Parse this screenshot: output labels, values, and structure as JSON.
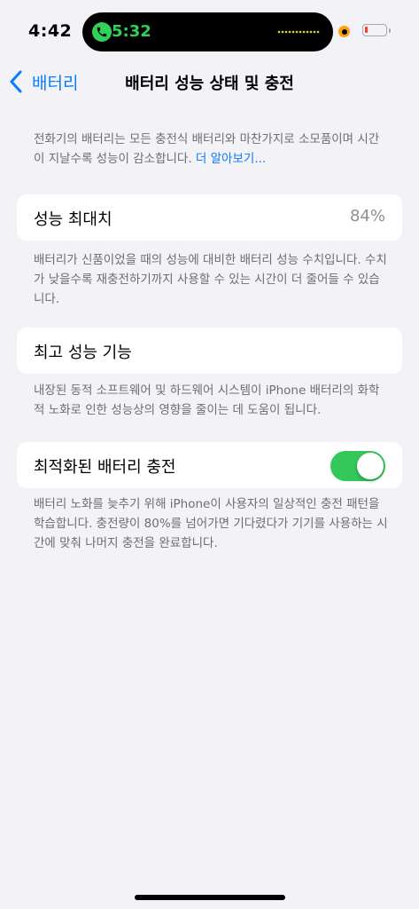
{
  "status_bar": {
    "time": "4:42",
    "island_call_time": "5:32",
    "call_color": "#30d158"
  },
  "nav": {
    "back_label": "배터리",
    "title": "배터리 성능 상태 및 충전",
    "accent": "#0a7aff"
  },
  "intro": {
    "text": "전화기의 배터리는 모든 충전식 배터리와 마찬가지로 소모품이며 시간이 지날수록 성능이 감소합니다.",
    "link": "더 알아보기..."
  },
  "max_capacity": {
    "label": "성능 최대치",
    "value": "84%",
    "footer": "배터리가 신품이었을 때의 성능에 대비한 배터리 성능 수치입니다. 수치가 낮을수록 재충전하기까지 사용할 수 있는 시간이 더 줄어들 수 있습니다."
  },
  "peak_performance": {
    "label": "최고 성능 기능",
    "footer": "내장된 동적 소프트웨어 및 하드웨어 시스템이 iPhone 배터리의 화학적 노화로 인한 성능상의 영향을 줄이는 데 도움이 됩니다."
  },
  "optimized_charging": {
    "label": "최적화된 배터리 충전",
    "enabled": true,
    "toggle_color": "#34c759",
    "footer": "배터리 노화를 늦추기 위해 iPhone이 사용자의 일상적인 충전 패턴을 학습합니다. 충전량이 80%를 넘어가면 기다렸다가 기기를 사용하는 시간에 맞춰 나머지 충전을 완료합니다."
  }
}
